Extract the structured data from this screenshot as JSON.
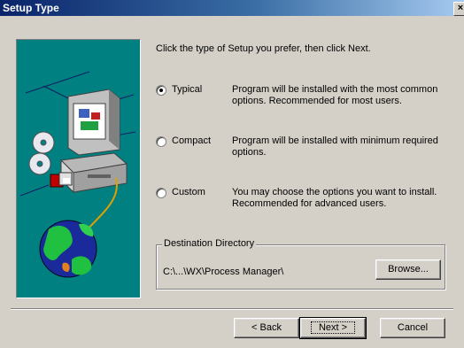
{
  "window": {
    "title": "Setup Type",
    "close_glyph": "×"
  },
  "prompt": "Click the type of Setup you prefer, then click Next.",
  "options": [
    {
      "label": "Typical",
      "description": "Program will be installed with the most common options. Recommended for most users.",
      "selected": true
    },
    {
      "label": "Compact",
      "description": "Program will be installed with minimum required options.",
      "selected": false
    },
    {
      "label": "Custom",
      "description": "You may choose the options you want to install. Recommended for advanced users.",
      "selected": false
    }
  ],
  "destination": {
    "title": "Destination Directory",
    "path": "C:\\...\\WX\\Process Manager\\",
    "browse_label": "Browse..."
  },
  "buttons": {
    "back_label": "< Back",
    "next_label": "Next >",
    "cancel_label": "Cancel"
  },
  "colors": {
    "title_start": "#0a246a",
    "title_end": "#a6caf0",
    "art_background": "#008080",
    "dialog_face": "#d4d0c8"
  },
  "icons": [
    "computer-icon",
    "cd-discs-icon",
    "floppy-disks-icon",
    "globe-icon"
  ]
}
